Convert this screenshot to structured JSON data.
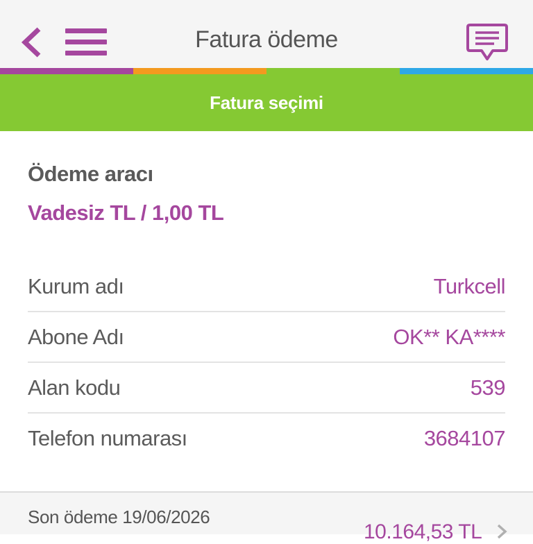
{
  "header": {
    "title": "Fatura ödeme",
    "back_icon": "chevron-left-icon",
    "menu_icon": "hamburger-menu-icon",
    "chat_icon": "chat-bubble-icon"
  },
  "colors": {
    "accent": "#a5479e",
    "green": "#85c933",
    "stripe_orange": "#f39a1f",
    "stripe_blue": "#2ea8e6"
  },
  "section_bar": {
    "label": "Fatura seçimi"
  },
  "payment_method": {
    "label": "Ödeme aracı",
    "value": "Vadesiz TL / 1,00 TL"
  },
  "details": [
    {
      "label": "Kurum adı",
      "value": "Turkcell"
    },
    {
      "label": "Abone Adı",
      "value": "OK** KA****"
    },
    {
      "label": "Alan kodu",
      "value": "539"
    },
    {
      "label": "Telefon numarası",
      "value": "3684107"
    }
  ],
  "bill": {
    "due_text": "Son ödeme 19/06/2026",
    "amount": "10.164,53 TL"
  }
}
